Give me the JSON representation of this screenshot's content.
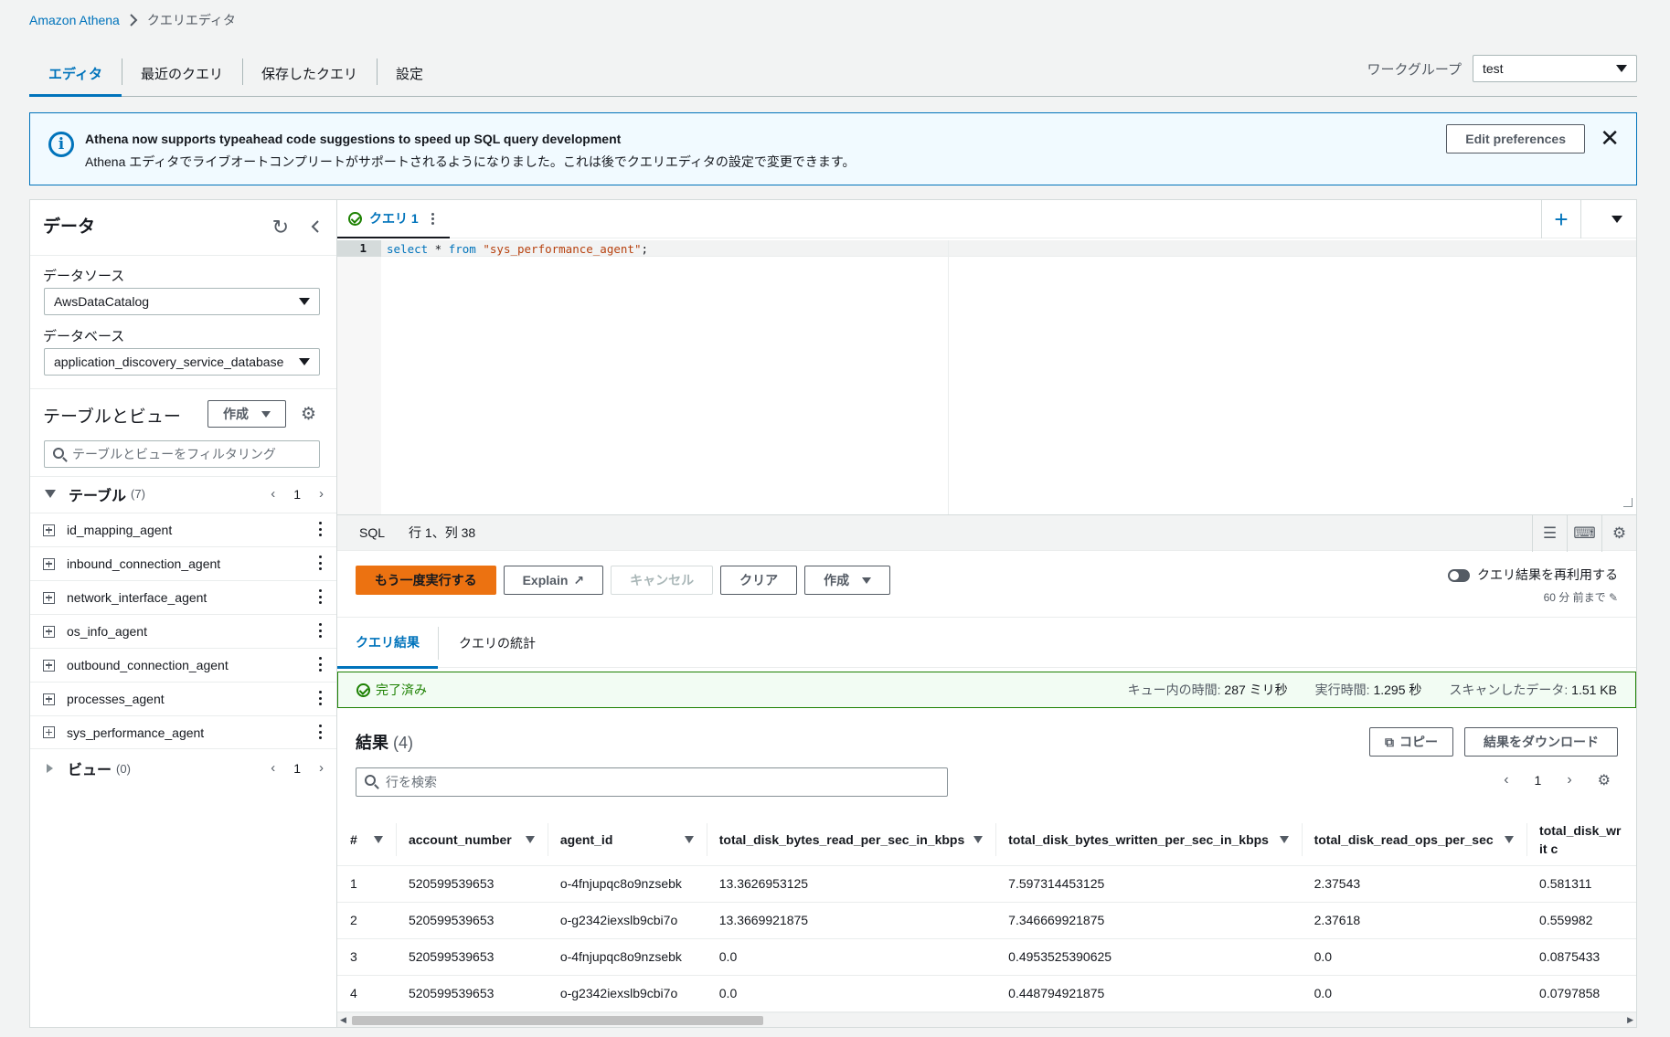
{
  "breadcrumb": {
    "root": "Amazon Athena",
    "current": "クエリエディタ"
  },
  "tabs": [
    "エディタ",
    "最近のクエリ",
    "保存したクエリ",
    "設定"
  ],
  "workgroup": {
    "label": "ワークグループ",
    "value": "test"
  },
  "flash": {
    "title": "Athena now supports typeahead code suggestions to speed up SQL query development",
    "body": "Athena エディタでライブオートコンプリートがサポートされるようになりました。これは後でクエリエディタの設定で変更できます。",
    "button": "Edit preferences"
  },
  "data_panel": {
    "title": "データ",
    "datasource_label": "データソース",
    "datasource": "AwsDataCatalog",
    "database_label": "データベース",
    "database": "application_discovery_service_database",
    "tables_views_title": "テーブルとビュー",
    "create_label": "作成",
    "filter_placeholder": "テーブルとビューをフィルタリング",
    "tables_title": "テーブル",
    "tables_count": "(7)",
    "tables_page": "1",
    "tables": [
      "id_mapping_agent",
      "inbound_connection_agent",
      "network_interface_agent",
      "os_info_agent",
      "outbound_connection_agent",
      "processes_agent",
      "sys_performance_agent"
    ],
    "views_title": "ビュー",
    "views_count": "(0)",
    "views_page": "1"
  },
  "query_tab": {
    "label": "クエリ 1"
  },
  "editor": {
    "line_number": "1",
    "kw1": "select",
    "mid": " * ",
    "kw2": "from",
    "space": " ",
    "string": "\"sys_performance_agent\"",
    "end": ";"
  },
  "status": {
    "lang": "SQL",
    "position": "行 1、列 38"
  },
  "actions": {
    "run": "もう一度実行する",
    "explain": "Explain",
    "cancel": "キャンセル",
    "clear": "クリア",
    "create": "作成"
  },
  "reuse": {
    "label": "クエリ結果を再利用する",
    "sub": "60 分 前まで"
  },
  "result_tabs": [
    "クエリ結果",
    "クエリの統計"
  ],
  "completion": {
    "status": "完了済み",
    "queue_label": "キュー内の時間:",
    "queue_value": "287 ミリ秒",
    "exec_label": "実行時間:",
    "exec_value": "1.295 秒",
    "scan_label": "スキャンしたデータ:",
    "scan_value": "1.51 KB"
  },
  "results": {
    "title": "結果",
    "count": "(4)",
    "copy": "コピー",
    "download": "結果をダウンロード",
    "search_placeholder": "行を検索",
    "page": "1",
    "columns": [
      "#",
      "account_number",
      "agent_id",
      "total_disk_bytes_read_per_sec_in_kbps",
      "total_disk_bytes_written_per_sec_in_kbps",
      "total_disk_read_ops_per_sec",
      "total_disk_writ c"
    ],
    "rows": [
      [
        "1",
        "520599539653",
        "o-4fnjupqc8o9nzsebk",
        "13.3626953125",
        "7.597314453125",
        "2.37543",
        "0.581311"
      ],
      [
        "2",
        "520599539653",
        "o-g2342iexslb9cbi7o",
        "13.3669921875",
        "7.346669921875",
        "2.37618",
        "0.559982"
      ],
      [
        "3",
        "520599539653",
        "o-4fnjupqc8o9nzsebk",
        "0.0",
        "0.4953525390625",
        "0.0",
        "0.0875433"
      ],
      [
        "4",
        "520599539653",
        "o-g2342iexslb9cbi7o",
        "0.0",
        "0.448794921875",
        "0.0",
        "0.0797858"
      ]
    ]
  }
}
